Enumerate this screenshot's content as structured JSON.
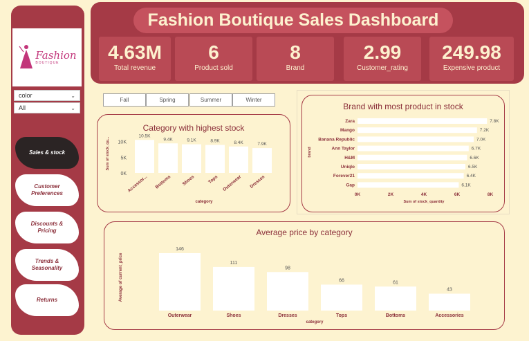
{
  "sidebar": {
    "logo": {
      "brand": "Fashion",
      "sub": "BOUTIQUE"
    },
    "slicers": [
      {
        "label": "color"
      },
      {
        "label": "All"
      }
    ],
    "nav": [
      {
        "label": "Sales & stock",
        "active": true
      },
      {
        "label": "Customer Preferences",
        "active": false
      },
      {
        "label": "Discounts & Pricing",
        "active": false
      },
      {
        "label": "Trends & Seasonality",
        "active": false
      },
      {
        "label": "Returns",
        "active": false
      }
    ]
  },
  "header": {
    "title": "Fashion Boutique Sales Dashboard",
    "kpis": [
      {
        "value": "4.63M",
        "label": "Total revenue"
      },
      {
        "value": "6",
        "label": "Product sold"
      },
      {
        "value": "8",
        "label": "Brand"
      },
      {
        "value": "2.99",
        "label": "Customer_rating"
      },
      {
        "value": "249.98",
        "label": "Expensive product"
      }
    ]
  },
  "seasons": [
    "Fall",
    "Spring",
    "Summer",
    "Winter"
  ],
  "colors": {
    "accent": "#a53a46",
    "background": "#fdf3d0",
    "bar": "#ffffff",
    "active_nav": "#2b2424"
  },
  "chart_data": [
    {
      "type": "bar",
      "title": "Category with highest stock",
      "xlabel": "category",
      "ylabel": "Sum of stock_qu...",
      "categories": [
        "Accessor...",
        "Bottoms",
        "Shoes",
        "Tops",
        "Outerwear",
        "Dresses"
      ],
      "values": [
        10500,
        9400,
        9100,
        8900,
        8400,
        7900
      ],
      "labels": [
        "10.5K",
        "9.4K",
        "9.1K",
        "8.9K",
        "8.4K",
        "7.9K"
      ],
      "yticks": [
        "0K",
        "5K",
        "10K"
      ],
      "ylim": [
        0,
        11000
      ]
    },
    {
      "type": "bar",
      "orientation": "horizontal",
      "title": "Brand with most product in stock",
      "xlabel": "Sum of stock_quantity",
      "ylabel": "brand",
      "categories": [
        "Zara",
        "Mango",
        "Banana Republic",
        "Ann Taylor",
        "H&M",
        "Uniqlo",
        "Forever21",
        "Gap"
      ],
      "values": [
        7800,
        7200,
        7000,
        6700,
        6600,
        6500,
        6400,
        6100
      ],
      "labels": [
        "7.8K",
        "7.2K",
        "7.0K",
        "6.7K",
        "6.6K",
        "6.5K",
        "6.4K",
        "6.1K"
      ],
      "xticks": [
        "0K",
        "2K",
        "4K",
        "6K",
        "8K"
      ],
      "xlim": [
        0,
        8000
      ]
    },
    {
      "type": "bar",
      "title": "Average price by category",
      "xlabel": "category",
      "ylabel": "Average of current_price",
      "categories": [
        "Outerwear",
        "Shoes",
        "Dresses",
        "Tops",
        "Bottoms",
        "Accessories"
      ],
      "values": [
        146,
        111,
        98,
        66,
        61,
        43
      ],
      "labels": [
        "146",
        "111",
        "98",
        "66",
        "61",
        "43"
      ],
      "ylim": [
        0,
        146
      ]
    }
  ]
}
